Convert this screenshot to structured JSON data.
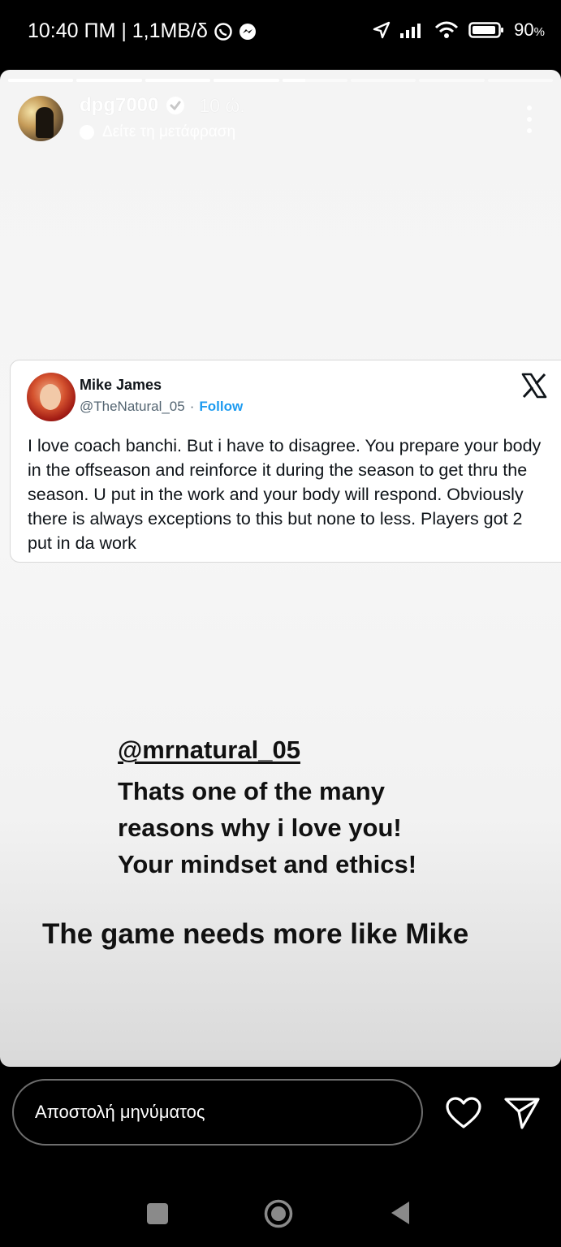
{
  "status_bar": {
    "left_text": "10:40 ΠΜ | 1,1MB/δ",
    "battery": "90",
    "battery_unit": "%"
  },
  "story": {
    "progress_segments": 8,
    "active_segment": 5,
    "active_progress": 0.35,
    "username": "dpg7000",
    "time_ago": "10 ώ.",
    "translate_label": "Δείτε τη μετάφραση"
  },
  "tweet": {
    "name": "Mike James",
    "handle": "@TheNatural_05",
    "separator": "·",
    "follow_label": "Follow",
    "text": "I love coach banchi. But i have to disagree. You prepare your body in the offseason and reinforce it during the season to get thru the season. U put in the work and your body will respond. Obviously there is always exceptions to this but none to less. Players got 2 put in da work"
  },
  "overlay": {
    "mention": "@mrnatural_05",
    "lines": [
      "Thats one of the many",
      "reasons why i love you!",
      "Your mindset and ethics!"
    ],
    "bottom": "The game needs more like Mike"
  },
  "reply_bar": {
    "placeholder": "Αποστολή μηνύματος"
  },
  "icons": {
    "status": [
      "whatsapp-icon",
      "messenger-icon",
      "location-icon",
      "signal-icon",
      "wifi-icon",
      "battery-icon"
    ],
    "story": [
      "verified-icon",
      "translate-icon",
      "more-options-icon",
      "x-logo-icon"
    ],
    "reply": [
      "heart-icon",
      "send-icon"
    ],
    "nav": [
      "recent-apps-icon",
      "home-icon",
      "back-icon"
    ]
  },
  "colors": {
    "follow": "#1d9bf0",
    "tweet_text": "#0f1419",
    "handle": "#536471"
  }
}
